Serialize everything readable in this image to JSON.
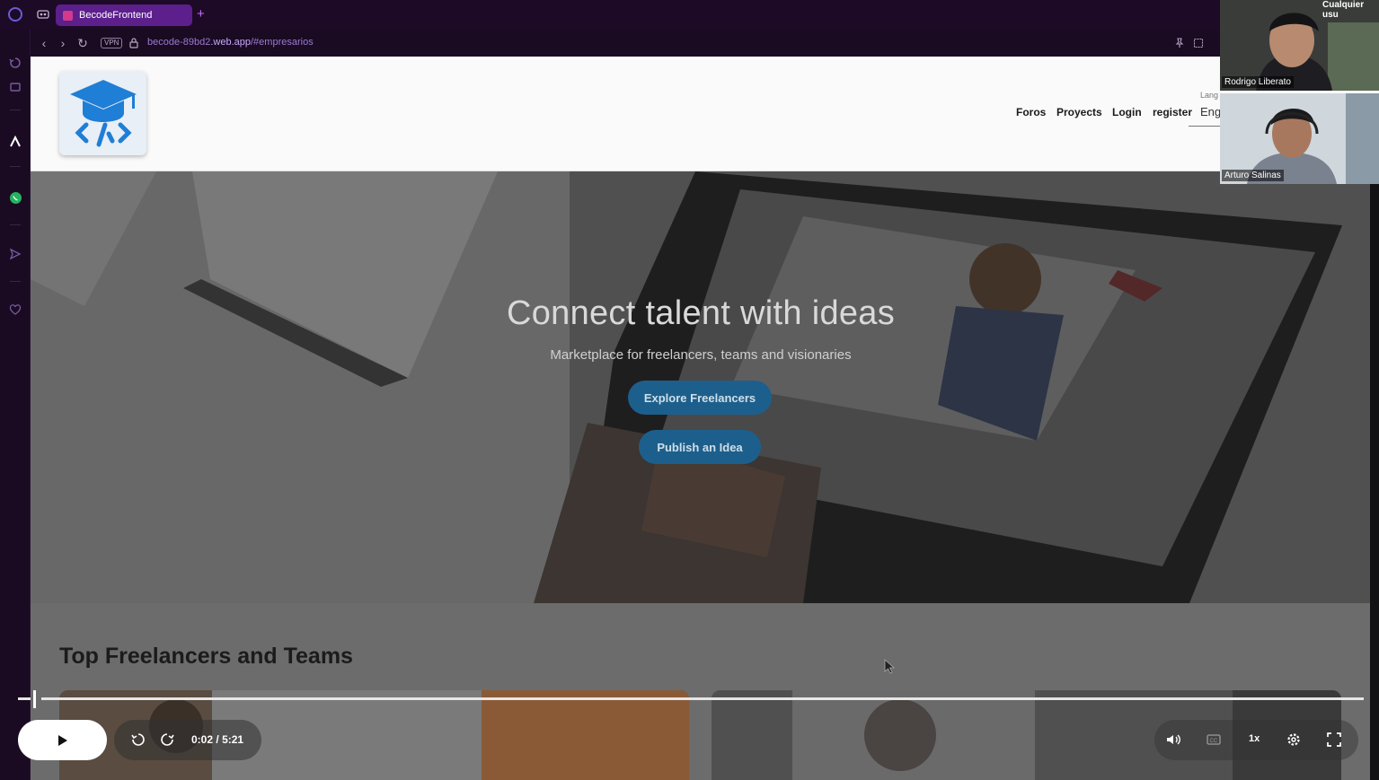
{
  "browser": {
    "tab_title": "BecodeFrontend",
    "new_tab": "+",
    "vpn_label": "VPN",
    "url_prefix": "becode-89bd2",
    "url_domain": ".web.app",
    "url_path": "/#empresarios"
  },
  "header": {
    "nav": [
      "Foros",
      "Proyects",
      "Login",
      "register"
    ],
    "language_label": "Lang",
    "language_value": "Eng"
  },
  "hero": {
    "title": "Connect talent with ideas",
    "subtitle": "Marketplace for freelancers, teams and visionaries",
    "explore_button": "Explore Freelancers",
    "publish_button": "Publish an Idea"
  },
  "section": {
    "title": "Top Freelancers and Teams"
  },
  "call": {
    "top_label": "Cualquier usu",
    "participants": [
      "Rodrigo Liberato",
      "Arturo Salinas"
    ]
  },
  "player": {
    "current_time": "0:02",
    "separator": "/",
    "duration": "5:21",
    "speed": "1x",
    "progress_fraction": 0.006
  },
  "colors": {
    "browser_accent": "#5c1f8c",
    "hero_button": "#1d5f8c",
    "url_color": "#9c7ad2"
  }
}
